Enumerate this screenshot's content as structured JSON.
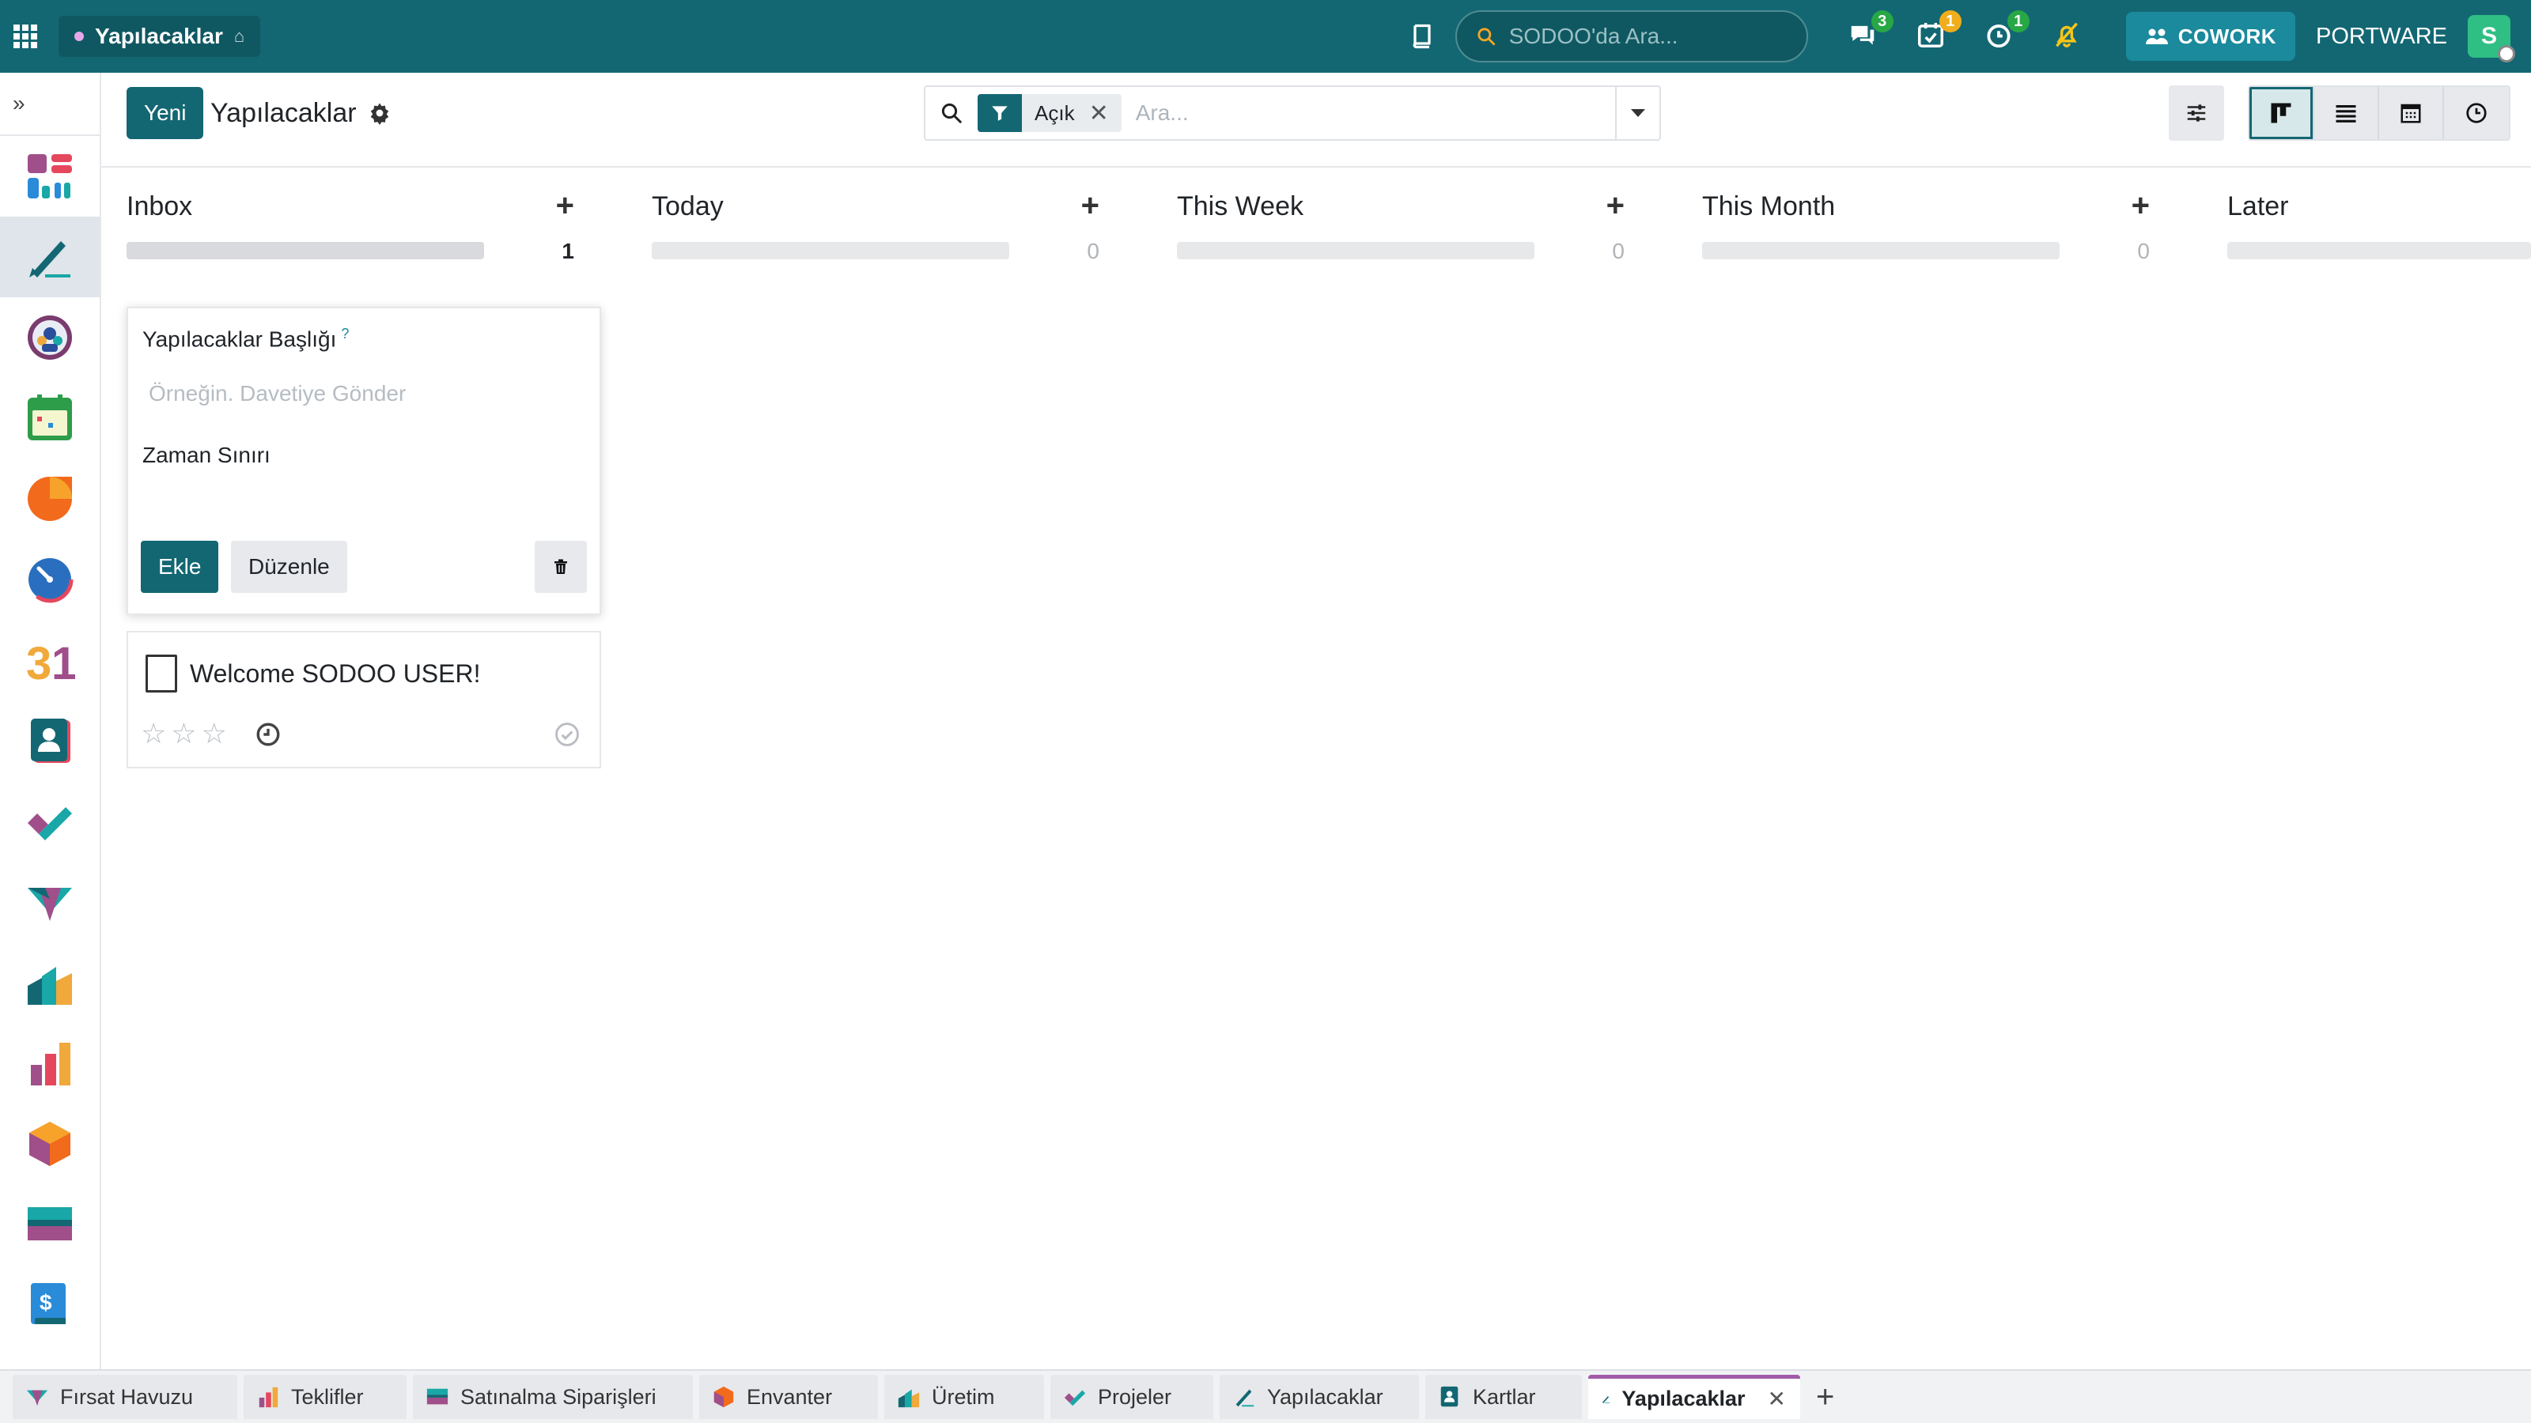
{
  "topbar": {
    "app_title": "Yapılacaklar",
    "search_placeholder": "SODOO'da Ara...",
    "messages_badge": "3",
    "activities_badge": "1",
    "timer_badge": "1",
    "cowork_label": "COWORK",
    "company_name": "PORTWARE",
    "avatar_letter": "S"
  },
  "control": {
    "new_button": "Yeni",
    "page_title": "Yapılacaklar",
    "facet_label": "Açık",
    "search_placeholder": "Ara..."
  },
  "columns": [
    {
      "title": "Inbox",
      "count": "1"
    },
    {
      "title": "Today",
      "count": "0"
    },
    {
      "title": "This Week",
      "count": "0"
    },
    {
      "title": "This Month",
      "count": "0"
    },
    {
      "title": "Later",
      "count": ""
    }
  ],
  "quick_create": {
    "title_label": "Yapılacaklar Başlığı",
    "help_mark": "?",
    "title_placeholder": "Örneğin. Davetiye Gönder",
    "deadline_label": "Zaman Sınırı",
    "add_button": "Ekle",
    "edit_button": "Düzenle"
  },
  "record": {
    "title": "Welcome SODOO USER!",
    "priority_stars": 0,
    "priority_max": 3
  },
  "bottom_tabs": [
    {
      "label": "Fırsat Havuzu",
      "icon": "crm-icon"
    },
    {
      "label": "Teklifler",
      "icon": "sales-icon"
    },
    {
      "label": "Satınalma Siparişleri",
      "icon": "purchase-icon"
    },
    {
      "label": "Envanter",
      "icon": "inventory-icon"
    },
    {
      "label": "Üretim",
      "icon": "manufacturing-icon"
    },
    {
      "label": "Projeler",
      "icon": "project-icon"
    },
    {
      "label": "Yapılacaklar",
      "icon": "todo-icon"
    },
    {
      "label": "Kartlar",
      "icon": "contacts-icon"
    },
    {
      "label": "Yapılacaklar",
      "icon": "todo-icon",
      "active": true
    }
  ],
  "colors": {
    "brand": "#136773",
    "accent_active_tab": "#a05ba8"
  }
}
